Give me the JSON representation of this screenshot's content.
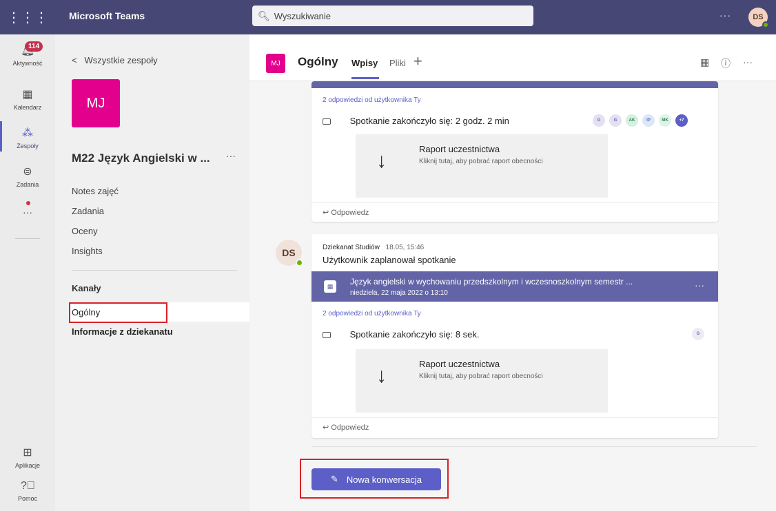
{
  "topbar": {
    "app_title": "Microsoft Teams",
    "search_placeholder": "Wyszukiwanie",
    "more": "···",
    "user_initials": "DS"
  },
  "rail": {
    "items": [
      {
        "label": "Aktywność",
        "icon": "bell-icon",
        "badge": "114"
      },
      {
        "label": "Kalendarz",
        "icon": "calendar-icon"
      },
      {
        "label": "Zespoły",
        "icon": "teams-icon"
      },
      {
        "label": "Zadania",
        "icon": "assignments-icon"
      },
      {
        "label": "···",
        "icon": "more-apps-icon"
      },
      {
        "label": "Aplikacje",
        "icon": "apps-icon"
      },
      {
        "label": "Pomoc",
        "icon": "help-icon"
      }
    ]
  },
  "panel": {
    "back_label": "Wszystkie zespoły",
    "team_initials": "MJ",
    "team_name": "M22 Język Angielski w ...",
    "team_more": "···",
    "menu": [
      "Notes zajęć",
      "Zadania",
      "Oceny",
      "Insights"
    ],
    "channels_heading": "Kanały",
    "channels": [
      "Ogólny",
      "Informacje z dziekanatu"
    ]
  },
  "header": {
    "channel_initials": "MJ",
    "channel_title": "Ogólny",
    "tabs": [
      "Wpisy",
      "Pliki"
    ],
    "add_tab": "+",
    "info_icon": "ⓘ",
    "more": "···"
  },
  "post1": {
    "replies_link": "2 odpowiedzi od użytkownika Ty",
    "meeting_ended": "Spotkanie zakończyło się: 2 godz. 2 min",
    "participants": [
      {
        "initials": "G",
        "color": "#e3e0f2",
        "text_color": "#6264a7"
      },
      {
        "initials": "G",
        "color": "#e3e0f2",
        "text_color": "#6264a7"
      },
      {
        "initials": "AK",
        "color": "#d6f0e0",
        "text_color": "#2e7d4f"
      },
      {
        "initials": "IP",
        "color": "#dce6f7",
        "text_color": "#4a6fb5"
      },
      {
        "initials": "MK",
        "color": "#dff2ea",
        "text_color": "#2e7d4f"
      },
      {
        "initials": "+7",
        "color": "#5b5fc7",
        "text_color": "#ffffff"
      }
    ],
    "report_title": "Raport uczestnictwa",
    "report_sub": "Kliknij tutaj, aby pobrać raport obecności",
    "reply_label": "Odpowiedz"
  },
  "post2": {
    "sender_initials": "DS",
    "sender": "Dziekanat Studiów",
    "time": "18.05, 15:46",
    "text": "Użytkownik zaplanował spotkanie",
    "event_title": "Język angielski w wychowaniu przedszkolnym i wczesnoszkolnym semestr ...",
    "event_date": "niedziela, 22 maja 2022 o 13:10",
    "event_more": "···",
    "replies_link": "2 odpowiedzi od użytkownika Ty",
    "meeting_ended": "Spotkanie zakończyło się: 8 sek.",
    "participants": [
      {
        "initials": "G",
        "color": "#ececf4",
        "text_color": "#6264a7"
      }
    ],
    "report_title": "Raport uczestnictwa",
    "report_sub": "Kliknij tutaj, aby pobrać raport obecności",
    "reply_label": "Odpowiedz"
  },
  "compose": {
    "new_conversation": "Nowa konwersacja"
  },
  "colors": {
    "topbar": "#464775",
    "accent": "#5b5fc7",
    "team_tile": "#e3008c",
    "highlight_box": "#d92027"
  }
}
